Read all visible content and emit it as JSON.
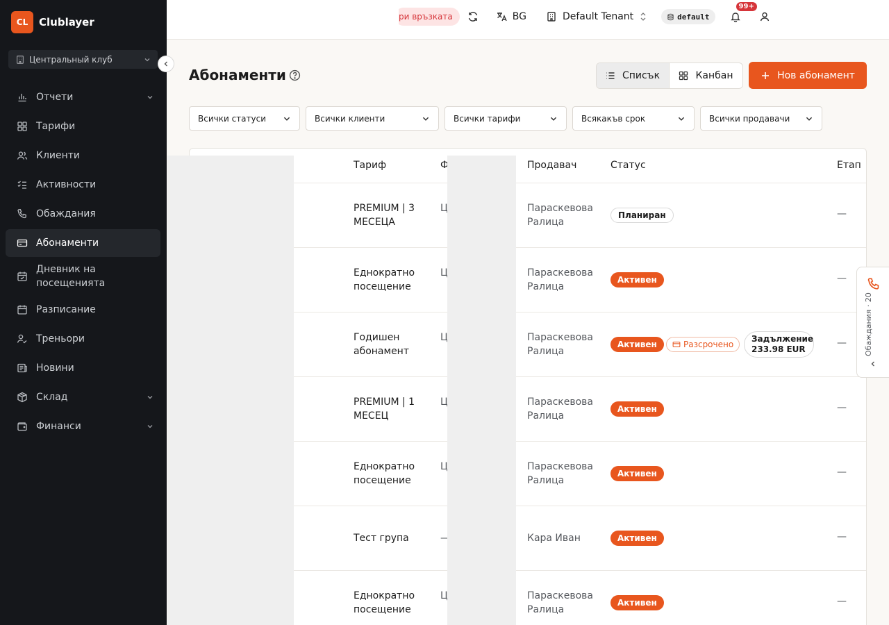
{
  "brand": {
    "logo_text": "CL",
    "name": "Clublayer"
  },
  "club_selector": {
    "label": "Центральный клуб"
  },
  "nav": {
    "items": [
      {
        "label": "Отчети",
        "icon": "bar-chart-icon",
        "has_children": true
      },
      {
        "label": "Тарифи",
        "icon": "tiles-icon",
        "has_children": false
      },
      {
        "label": "Клиенти",
        "icon": "users-icon",
        "has_children": false
      },
      {
        "label": "Активности",
        "icon": "list-check-icon",
        "has_children": false
      },
      {
        "label": "Обаждания",
        "icon": "phone-icon",
        "has_children": false
      },
      {
        "label": "Абонаменти",
        "icon": "credit-card-icon",
        "has_children": false,
        "active": true
      },
      {
        "label": "Дневник на посещенията",
        "icon": "calendar-check-icon",
        "has_children": false
      },
      {
        "label": "Разписание",
        "icon": "calendar-icon",
        "has_children": false
      },
      {
        "label": "Треньори",
        "icon": "user-check-icon",
        "has_children": false
      },
      {
        "label": "Новини",
        "icon": "newspaper-icon",
        "has_children": false
      },
      {
        "label": "Склад",
        "icon": "package-icon",
        "has_children": true
      },
      {
        "label": "Финанси",
        "icon": "wallet-icon",
        "has_children": true
      }
    ]
  },
  "topbar": {
    "connection_status": "ри връзката",
    "language": "BG",
    "tenant": "Default Tenant",
    "environment": "default",
    "notifications_count": "99+"
  },
  "page": {
    "title": "Абонаменти"
  },
  "view_toggle": {
    "list_label": "Списък",
    "kanban_label": "Канбан",
    "selected": "list"
  },
  "new_button": {
    "label": "Нов абонамент"
  },
  "filters": [
    {
      "label": "Всички статуси"
    },
    {
      "label": "Всички клиенти"
    },
    {
      "label": "Всички тарифи"
    },
    {
      "label": "Всякакъв срок"
    },
    {
      "label": "Всички продавачи"
    }
  ],
  "table": {
    "headers": {
      "tariff": "Тариф",
      "partial": "Ф",
      "seller": "Продавач",
      "status": "Статус",
      "stage": "Етап"
    },
    "rows": [
      {
        "tariff": "PREMIUM | 3 МЕСЕЦА",
        "partial": "Ц кл",
        "seller": "Параскевова Ралица",
        "status": "Планиран",
        "status_type": "planned",
        "installment": "",
        "debt_label": "",
        "debt_amount": "",
        "stage": "—"
      },
      {
        "tariff": "Еднократно посещение",
        "partial": "Ц кл",
        "seller": "Параскевова Ралица",
        "status": "Активен",
        "status_type": "active",
        "installment": "",
        "debt_label": "",
        "debt_amount": "",
        "stage": "—"
      },
      {
        "tariff": "Годишен абонамент",
        "partial": "Ц кл",
        "seller": "Параскевова Ралица",
        "status": "Активен",
        "status_type": "active",
        "installment": "Разсрочено",
        "debt_label": "Задължение",
        "debt_amount": "233.98 EUR",
        "stage": "—"
      },
      {
        "tariff": "PREMIUM | 1 МЕСЕЦ",
        "partial": "Ц кл",
        "seller": "Параскевова Ралица",
        "status": "Активен",
        "status_type": "active",
        "installment": "",
        "debt_label": "",
        "debt_amount": "",
        "stage": "—"
      },
      {
        "tariff": "Еднократно посещение",
        "partial": "Ц кл",
        "seller": "Параскевова Ралица",
        "status": "Активен",
        "status_type": "active",
        "installment": "",
        "debt_label": "",
        "debt_amount": "",
        "stage": "—"
      },
      {
        "tariff": "Тест група",
        "partial": "—",
        "seller": "Кара Иван",
        "status": "Активен",
        "status_type": "active",
        "installment": "",
        "debt_label": "",
        "debt_amount": "",
        "stage": "—"
      },
      {
        "tariff": "Еднократно посещение",
        "partial": "Ц кл",
        "seller": "Параскевова Ралица",
        "status": "Активен",
        "status_type": "active",
        "installment": "",
        "debt_label": "",
        "debt_amount": "",
        "stage": "—"
      }
    ]
  },
  "calls_tab": {
    "label": "Обаждания · 20"
  },
  "colors": {
    "accent": "#e8561e",
    "sidebar_bg": "#15171b",
    "danger": "#d6353a"
  }
}
